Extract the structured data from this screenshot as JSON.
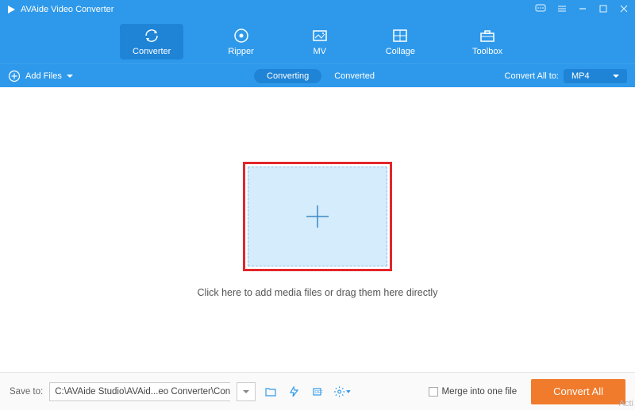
{
  "app": {
    "title": "AVAide Video Converter"
  },
  "nav": {
    "items": [
      {
        "label": "Converter"
      },
      {
        "label": "Ripper"
      },
      {
        "label": "MV"
      },
      {
        "label": "Collage"
      },
      {
        "label": "Toolbox"
      }
    ]
  },
  "actions": {
    "add_files": "Add Files",
    "tabs": {
      "converting": "Converting",
      "converted": "Converted"
    },
    "convert_all_to_label": "Convert All to:",
    "convert_all_to_value": "MP4"
  },
  "dropzone": {
    "text": "Click here to add media files or drag them here directly"
  },
  "footer": {
    "save_to_label": "Save to:",
    "save_path": "C:\\AVAide Studio\\AVAid...eo Converter\\Converted",
    "merge_label": "Merge into one file",
    "convert_all": "Convert All"
  },
  "watermark": "Acti"
}
